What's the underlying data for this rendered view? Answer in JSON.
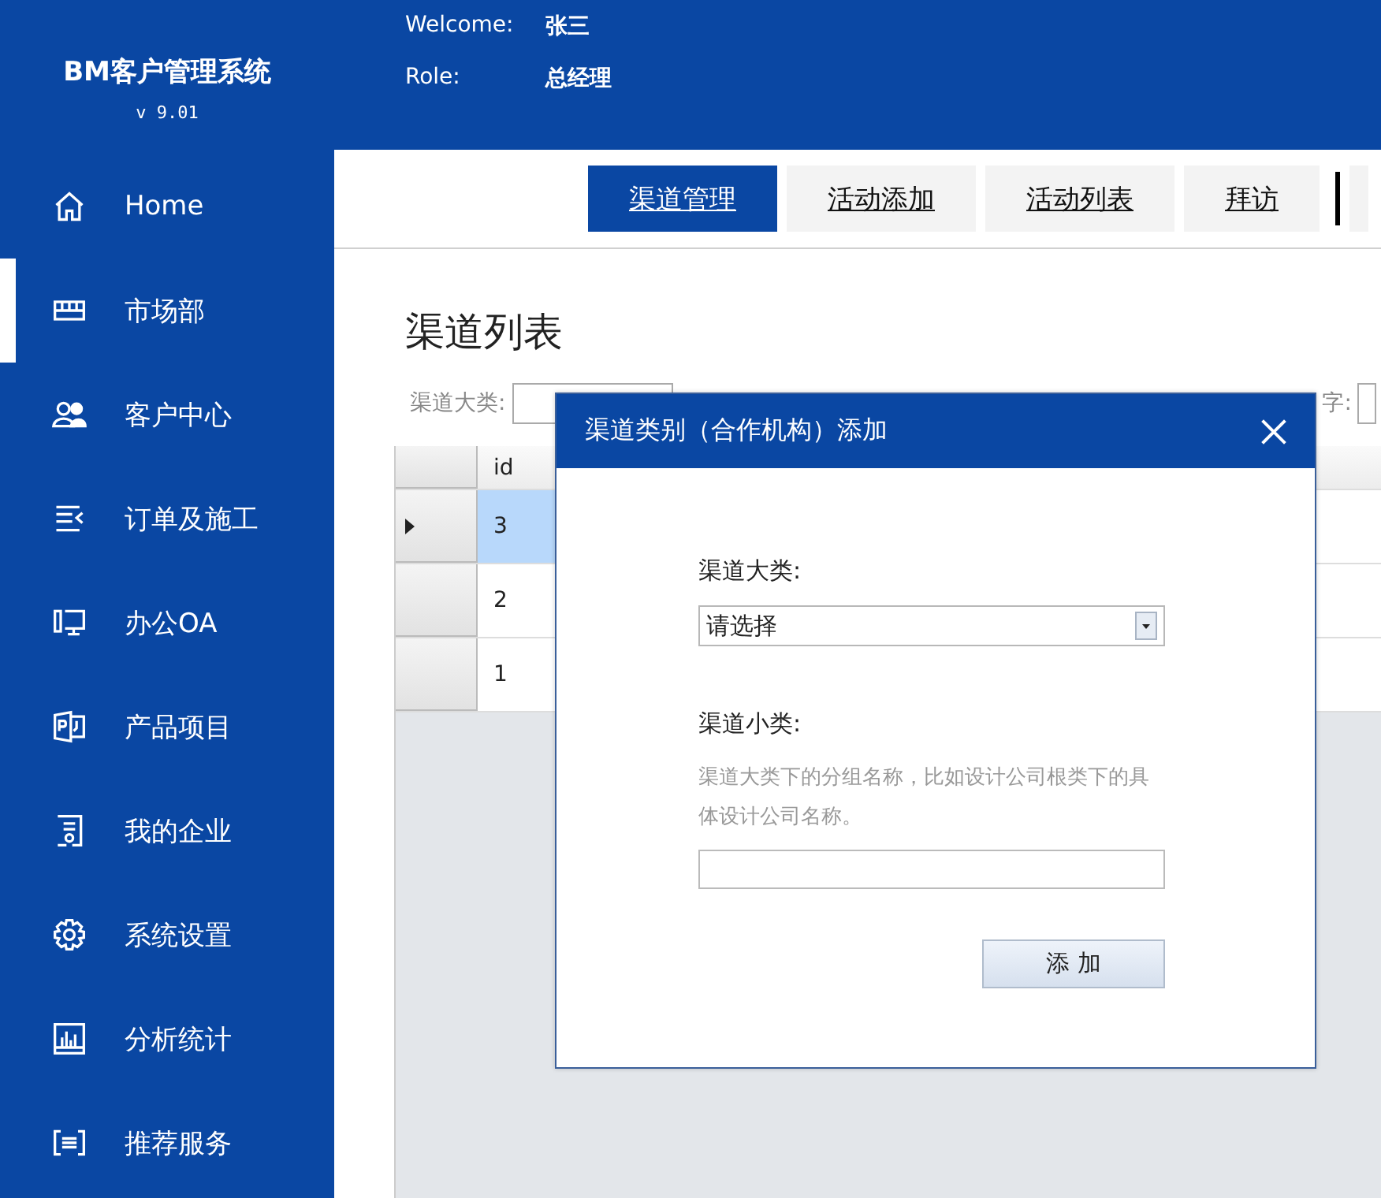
{
  "app": {
    "name": "BM客户管理系统",
    "version": "v 9.01"
  },
  "user": {
    "welcome_label": "Welcome:",
    "name": "张三",
    "role_label": "Role:",
    "role": "总经理"
  },
  "sidebar": {
    "items": [
      {
        "label": "Home",
        "selected": false
      },
      {
        "label": "市场部",
        "selected": true
      },
      {
        "label": "客户中心",
        "selected": false
      },
      {
        "label": "订单及施工",
        "selected": false
      },
      {
        "label": "办公OA",
        "selected": false
      },
      {
        "label": "产品项目",
        "selected": false
      },
      {
        "label": "我的企业",
        "selected": false
      },
      {
        "label": "系统设置",
        "selected": false
      },
      {
        "label": "分析统计",
        "selected": false
      },
      {
        "label": "推荐服务",
        "selected": false
      }
    ]
  },
  "tabs": [
    {
      "label": "渠道管理",
      "selected": true
    },
    {
      "label": "活动添加",
      "selected": false
    },
    {
      "label": "活动列表",
      "selected": false
    },
    {
      "label": "拜访",
      "selected": false
    }
  ],
  "page_title": "渠道列表",
  "filters": [
    {
      "label": "渠道大类:"
    },
    {
      "label": "字:"
    }
  ],
  "grid": {
    "columns": [
      "id"
    ],
    "rows": [
      {
        "id": "3",
        "selected": true
      },
      {
        "id": "2",
        "selected": false
      },
      {
        "id": "1",
        "selected": false
      }
    ]
  },
  "dialog": {
    "title": "渠道类别（合作机构）添加",
    "major_label": "渠道大类:",
    "major_value": "请选择",
    "minor_label": "渠道小类:",
    "minor_hint": "渠道大类下的分组名称，比如设计公司根类下的具体设计公司名称。",
    "button": "添 加"
  }
}
